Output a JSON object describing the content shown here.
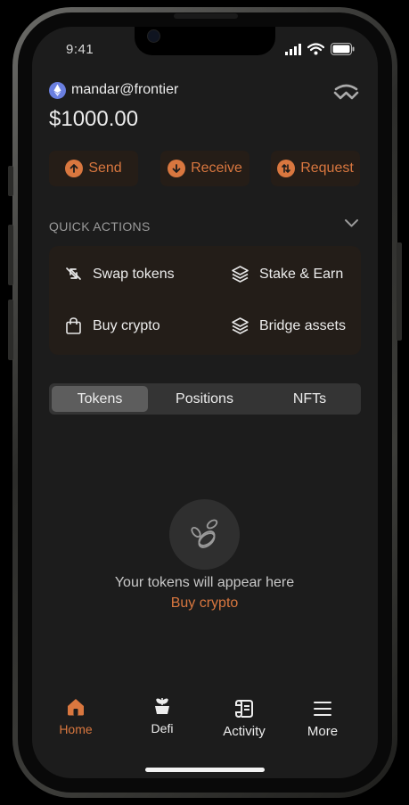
{
  "status_bar": {
    "time": "9:41"
  },
  "account": {
    "username": "mandar@frontier",
    "balance": "$1000.00"
  },
  "actions": [
    {
      "label": "Send",
      "icon": "arrow-up-icon"
    },
    {
      "label": "Receive",
      "icon": "arrow-down-icon"
    },
    {
      "label": "Request",
      "icon": "request-icon"
    }
  ],
  "quick_actions": {
    "title": "QUICK ACTIONS",
    "items": [
      {
        "label": "Swap tokens",
        "icon": "swap-icon"
      },
      {
        "label": "Stake & Earn",
        "icon": "layers-icon"
      },
      {
        "label": "Buy crypto",
        "icon": "bag-icon"
      },
      {
        "label": "Bridge assets",
        "icon": "layers-icon"
      }
    ]
  },
  "tabs": [
    "Tokens",
    "Positions",
    "NFTs"
  ],
  "active_tab": "Tokens",
  "empty_state": {
    "message": "Your tokens will appear here",
    "link": "Buy crypto"
  },
  "bottom_nav": [
    {
      "label": "Home",
      "icon": "home-icon",
      "active": true
    },
    {
      "label": "Defi",
      "icon": "plant-icon"
    },
    {
      "label": "Activity",
      "icon": "scroll-icon"
    },
    {
      "label": "More",
      "icon": "menu-icon"
    }
  ],
  "colors": {
    "accent": "#d9773f",
    "background": "#1c1c1c",
    "card": "#231d18"
  }
}
